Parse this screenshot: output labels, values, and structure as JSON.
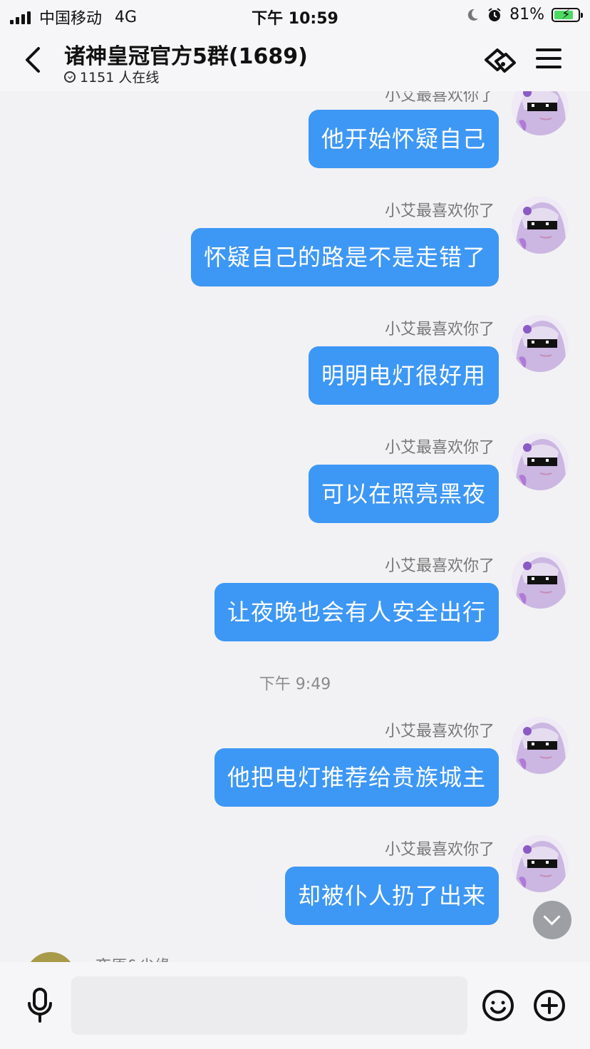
{
  "status_bar": {
    "carrier": "中国移动",
    "network": "4G",
    "time": "下午 10:59",
    "battery_pct": "81%",
    "battery_level": 0.81
  },
  "header": {
    "title": "诸神皇冠官方5群(1689)",
    "online": "1151 人在线"
  },
  "chat": {
    "top_partial_sender": "小艾最喜欢你了",
    "messages": [
      {
        "sender": "",
        "text": "他开始怀疑自己"
      },
      {
        "sender": "小艾最喜欢你了",
        "text": "怀疑自己的路是不是走错了"
      },
      {
        "sender": "小艾最喜欢你了",
        "text": "明明电灯很好用"
      },
      {
        "sender": "小艾最喜欢你了",
        "text": "可以在照亮黑夜"
      },
      {
        "sender": "小艾最喜欢你了",
        "text": "让夜晚也会有人安全出行"
      },
      {
        "sender": "小艾最喜欢你了",
        "text": "他把电灯推荐给贵族城主"
      },
      {
        "sender": "小艾最喜欢你了",
        "text": "却被仆人扔了出来"
      }
    ],
    "timestamp": "下午 9:49",
    "next_sender_partial": "夜原&尘缘"
  },
  "icons": {
    "back": "chevron-left-icon",
    "group_tool": "link-tag-icon",
    "menu": "hamburger-menu-icon",
    "mic": "microphone-icon",
    "emoji": "smiley-icon",
    "plus": "plus-circle-icon",
    "scroll": "chevron-down-icon"
  },
  "colors": {
    "bubble": "#3d97f5",
    "background": "#f2f2f4",
    "battery_fill": "#4cd964"
  }
}
